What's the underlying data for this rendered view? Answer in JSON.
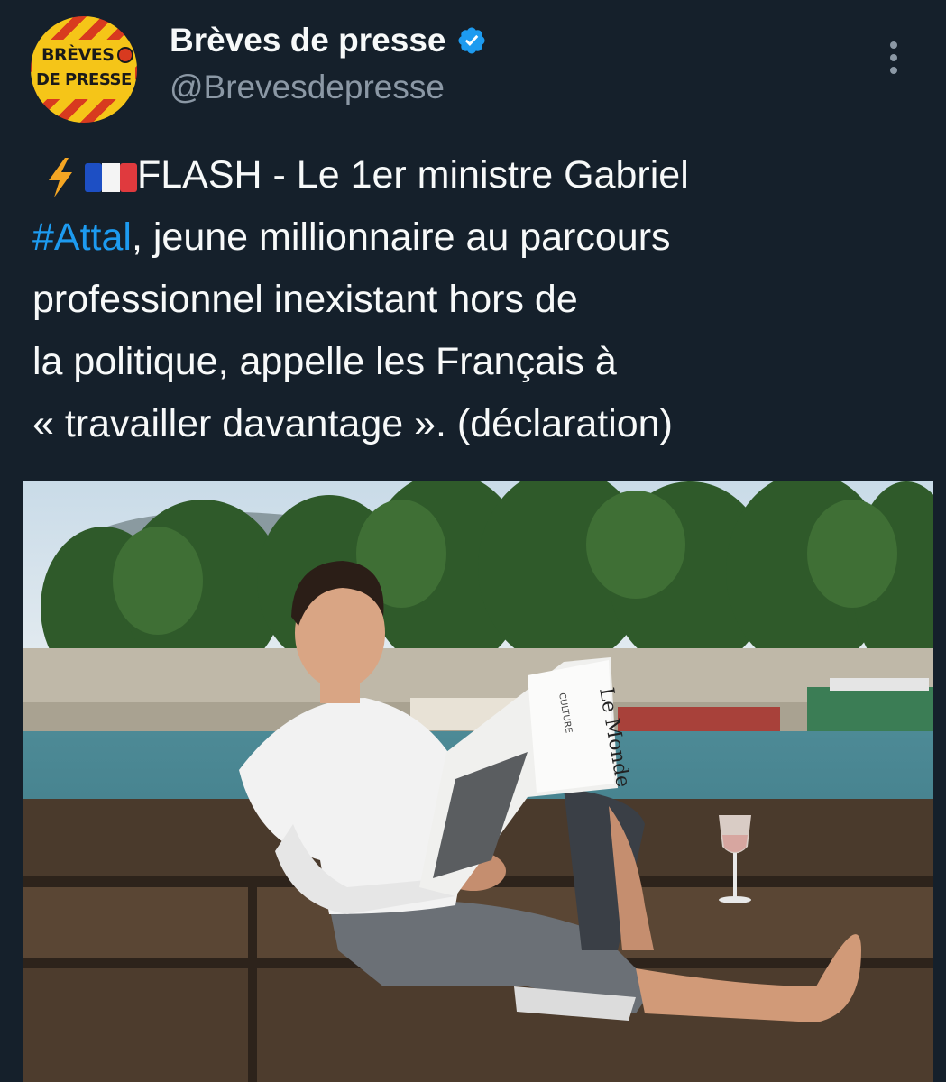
{
  "author": {
    "display_name": "Brèves de presse",
    "handle": "@Brevesdepresse",
    "avatar_line1": "BRÈVES",
    "avatar_line2": "DE PRESSE",
    "verified": true
  },
  "tweet": {
    "emoji_1": "lightning-emoji",
    "emoji_2": "france-flag-emoji",
    "line1_text": "FLASH - Le 1er ministre Gabriel",
    "hashtag": "#Attal",
    "line2_rest": ", jeune millionnaire au parcours",
    "line3": "professionnel inexistant hors de",
    "line4": "la politique, appelle les Français à",
    "line5": "« travailler davantage ». (déclaration)"
  },
  "colors": {
    "background": "#15202b",
    "text": "#f7f9f9",
    "secondary": "#8b98a5",
    "link": "#1d9bf0"
  },
  "icons": {
    "verified": "verified-badge-icon",
    "more": "more-vertical-icon"
  },
  "media": {
    "newspaper_masthead": "Le Monde",
    "newspaper_section": "CULTURE"
  }
}
